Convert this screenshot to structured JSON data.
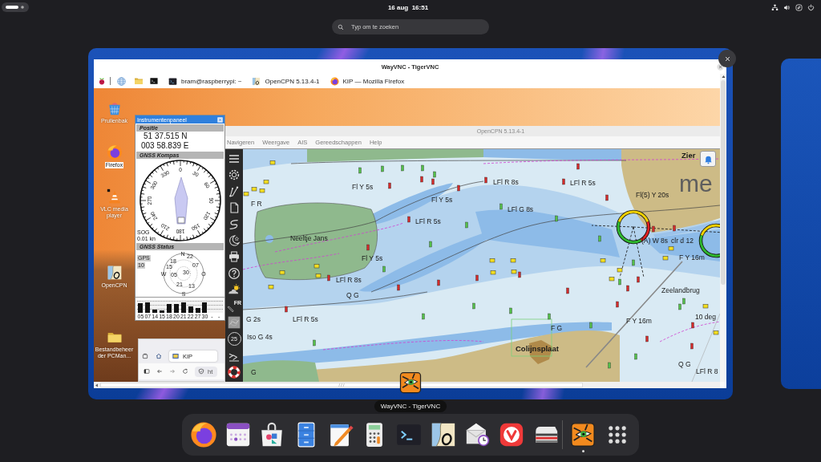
{
  "top_bar": {
    "clock": "16 aug  16:51"
  },
  "search": {
    "placeholder": "Typ om te zoeken"
  },
  "window_preview": {
    "title": "WayVNC - TigerVNC",
    "tooltip": "WayVNC - TigerVNC"
  },
  "remote_panel": {
    "windows": [
      {
        "kind": "terminal",
        "label": "bram@raspberrypi: ~"
      },
      {
        "kind": "chart",
        "label": "OpenCPN 5.13.4-1"
      },
      {
        "kind": "browser",
        "label": "KIP — Mozilla Firefox"
      }
    ]
  },
  "desktop_icons": [
    {
      "kind": "trash",
      "label": "Prullenbak",
      "selected": false
    },
    {
      "kind": "browser",
      "label": "Firefox",
      "selected": true
    },
    {
      "kind": "cone",
      "label": "VLC media player",
      "selected": false
    },
    {
      "kind": "chart",
      "label": "OpenCPN",
      "selected": false
    },
    {
      "kind": "folder",
      "label": "Bestandbeheerder PCMan...",
      "selected": false
    }
  ],
  "instrument_panel": {
    "title": "Instrumentenpaneel",
    "position": {
      "heading": "Positie",
      "latitude": "51 37.515 N",
      "longitude": "003 58.839 E"
    },
    "compass": {
      "heading": "GNSS Kompas",
      "dial_labels": [
        "0",
        "30",
        "60",
        "90",
        "120",
        "150",
        "180",
        "210",
        "240",
        "270",
        "300",
        "330"
      ],
      "sog_label": "SOG",
      "sog": "0.01 kn"
    },
    "gnss_status": {
      "heading": "GNSS Status",
      "system": "GPS",
      "count": "10",
      "sky_labels": [
        "18",
        "N",
        "22",
        "07",
        "15",
        "W",
        "05",
        "30",
        "O",
        "21",
        "13",
        "S"
      ],
      "satellites": [
        {
          "id": "05",
          "level": 0.72
        },
        {
          "id": "07",
          "level": 0.83
        },
        {
          "id": "14",
          "level": 0.28
        },
        {
          "id": "15",
          "level": 0.19
        },
        {
          "id": "18",
          "level": 0.67
        },
        {
          "id": "20",
          "level": 0.67
        },
        {
          "id": "21",
          "level": 0.83
        },
        {
          "id": "22",
          "level": 0.5
        },
        {
          "id": "27",
          "level": 0.39
        },
        {
          "id": "30",
          "level": 0.83
        },
        {
          "id": "-"
        },
        {
          "id": "-"
        }
      ]
    }
  },
  "browser_window": {
    "tab": "KIP",
    "address": "ht"
  },
  "opencpn": {
    "title": "OpenCPN 5.13.4-1",
    "menu": [
      "Navigeren",
      "Weergave",
      "AIS",
      "Gereedschappen",
      "Help"
    ],
    "toolbar": [
      {
        "kind": "menu"
      },
      {
        "kind": "settings"
      },
      {
        "kind": "route"
      },
      {
        "kind": "page"
      },
      {
        "kind": "track"
      },
      {
        "kind": "night"
      },
      {
        "kind": "print"
      },
      {
        "kind": "help"
      },
      {
        "kind": "weather"
      },
      {
        "kind": "measure",
        "label": "FR"
      },
      {
        "kind": "tide"
      },
      {
        "kind": "current",
        "label": "25"
      },
      {
        "kind": "dashboard"
      },
      {
        "kind": "lifebuoy"
      }
    ],
    "map_labels": [
      "Zier",
      "Fl Y 5s",
      "LFl R 8s",
      "LFl R 5s",
      "me",
      "Fl Y 5s",
      "Fl(5) Y 20s",
      "F R",
      "LFl G 8s",
      "LFl R 5s",
      "Neeltje Jans",
      "(A) W 8s",
      "clr d 12",
      "Fl Y 5s",
      "F Y 16m",
      "LFl R 8s",
      "Q G",
      "Zeelandbrug",
      "G 2s",
      "LFl R 5s",
      "F Y 16m",
      "10 deg",
      "F G",
      "Iso G 4s",
      "Colijnsplaat",
      "G",
      "Q G",
      "LFl R 8"
    ]
  },
  "dock": {
    "pinned_apps": [
      {
        "kind": "browser",
        "running": false
      },
      {
        "kind": "calendar",
        "running": false
      },
      {
        "kind": "software",
        "running": false
      },
      {
        "kind": "files",
        "running": false
      },
      {
        "kind": "editor",
        "running": false
      },
      {
        "kind": "calculator",
        "running": false
      },
      {
        "kind": "terminal",
        "running": false
      },
      {
        "kind": "chart",
        "running": false
      },
      {
        "kind": "mail",
        "running": false
      },
      {
        "kind": "vivaldi",
        "running": false
      },
      {
        "kind": "drive",
        "running": false
      }
    ],
    "open_apps": [
      {
        "kind": "vnc",
        "running": true
      }
    ]
  }
}
